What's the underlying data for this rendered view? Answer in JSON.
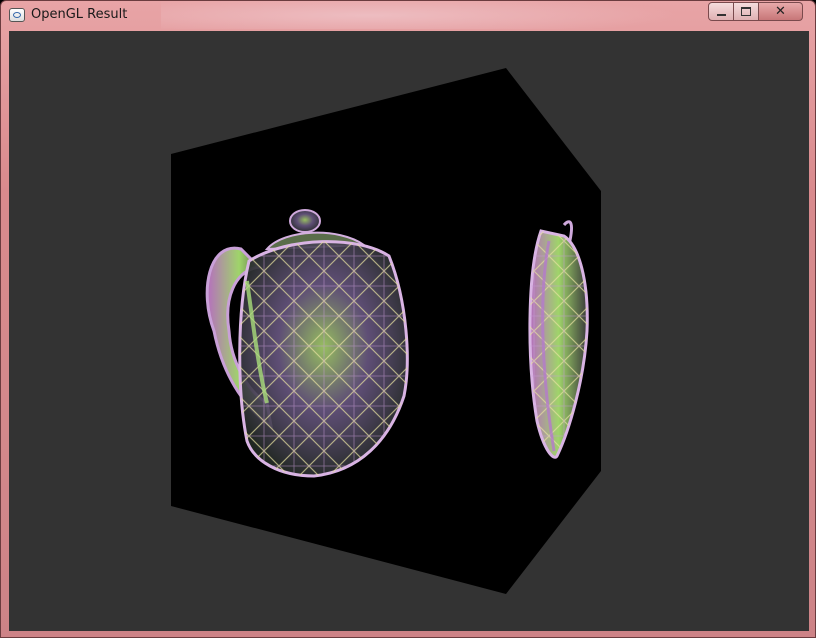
{
  "window": {
    "title": "OpenGL Result",
    "controls": {
      "minimize_icon": "minimize-icon",
      "maximize_icon": "maximize-icon",
      "close_icon": "close-icon"
    }
  },
  "scene": {
    "background_color": "#333333",
    "cube_color": "#000000",
    "objects": [
      "teapot-front-face",
      "teapot-right-face"
    ]
  }
}
